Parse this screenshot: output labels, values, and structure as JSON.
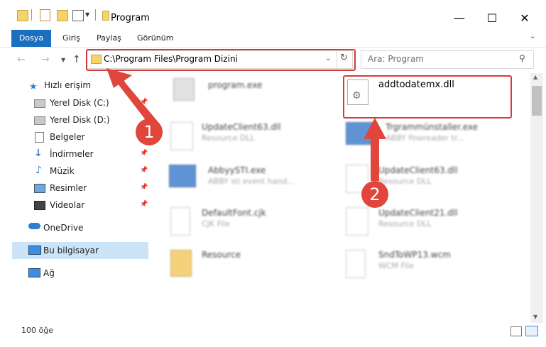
{
  "window": {
    "title": "Program"
  },
  "ribbon": {
    "tabs": [
      "Dosya",
      "Giriş",
      "Paylaş",
      "Görünüm"
    ]
  },
  "address": {
    "path": "C:\\Program Files\\Program Dizini"
  },
  "search": {
    "placeholder": "Ara: Program"
  },
  "sidebar": {
    "items": [
      {
        "label": "Hızlı erişim",
        "icon": "star-icon"
      },
      {
        "label": "Yerel Disk (C:)",
        "icon": "drive-icon",
        "pinned": true
      },
      {
        "label": "Yerel Disk (D:)",
        "icon": "drive-icon"
      },
      {
        "label": "Belgeler",
        "icon": "documents-icon"
      },
      {
        "label": "İndirmeler",
        "icon": "download-icon",
        "pinned": true
      },
      {
        "label": "Müzik",
        "icon": "music-icon",
        "pinned": true
      },
      {
        "label": "Resimler",
        "icon": "pictures-icon",
        "pinned": true
      },
      {
        "label": "Videolar",
        "icon": "videos-icon",
        "pinned": true
      },
      {
        "label": "OneDrive",
        "icon": "cloud-icon"
      },
      {
        "label": "Bu bilgisayar",
        "icon": "computer-icon",
        "selected": true
      },
      {
        "label": "Ağ",
        "icon": "network-icon"
      }
    ]
  },
  "files": [
    {
      "name": "program.exe",
      "sub": ""
    },
    {
      "name": "addtodatemx.dll",
      "sub": ""
    },
    {
      "name": "UpdateClient63.dll",
      "sub": "Resource DLL"
    },
    {
      "name": "Trgrammünstaller.exe",
      "sub": "ABBY finereader tr..."
    },
    {
      "name": "AbbyySTI.exe",
      "sub": "ABBY sti event hand..."
    },
    {
      "name": "UpdateClient63.dll",
      "sub": "Resource DLL"
    },
    {
      "name": "DefaultFont.cjk",
      "sub": "CJK File"
    },
    {
      "name": "UpdateClient21.dll",
      "sub": "Resource DLL"
    },
    {
      "name": "Resource",
      "sub": ""
    },
    {
      "name": "SndToWP13.wcm",
      "sub": "WCM File"
    }
  ],
  "status": {
    "count": "100 öğe"
  },
  "callouts": {
    "one": "1",
    "two": "2"
  },
  "colors": {
    "accent": "#1a6fbf",
    "highlight": "#d63b3b",
    "selected": "#cce4f7"
  }
}
